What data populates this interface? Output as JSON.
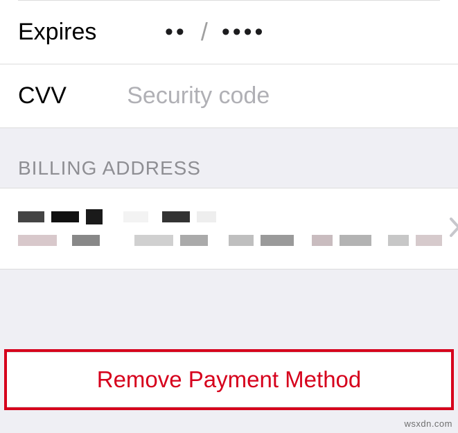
{
  "card": {
    "expires_label": "Expires",
    "expires_mm": "••",
    "expires_slash": "/",
    "expires_yyyy": "••••",
    "cvv_label": "CVV",
    "cvv_placeholder": "Security code"
  },
  "billing": {
    "header": "BILLING ADDRESS"
  },
  "actions": {
    "remove_label": "Remove Payment Method"
  },
  "watermark": "wsxdn.com"
}
